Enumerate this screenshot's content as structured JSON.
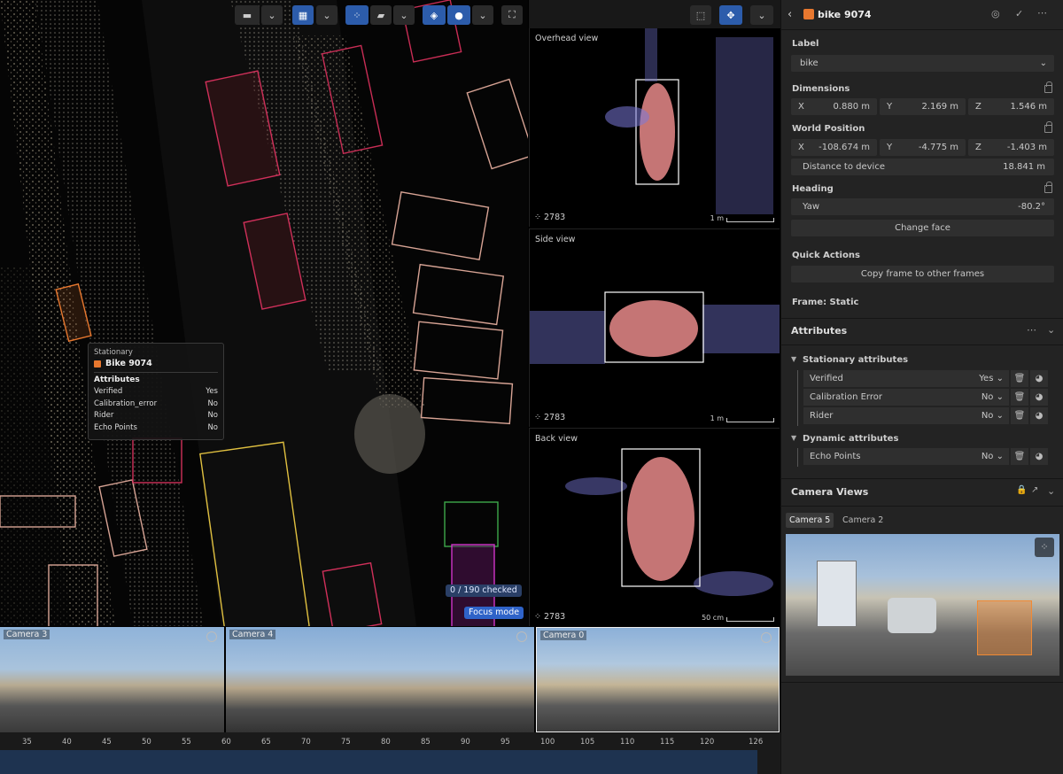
{
  "viewport": {
    "checked_badge": "0 / 190 checked",
    "focus_badge": "Focus mode",
    "toolbar": [
      "video-camera-icon",
      "chevron-down-icon",
      "layout-grid-icon",
      "chevron-down-icon",
      "points-icon",
      "tag-icon",
      "chevron-down-icon",
      "layers-icon",
      "circle-icon",
      "chevron-down-icon",
      "fullscreen-icon"
    ]
  },
  "tooltip": {
    "state": "Stationary",
    "object": "Bike 9074",
    "section": "Attributes",
    "rows": [
      {
        "k": "Verified",
        "v": "Yes"
      },
      {
        "k": "Calibration_error",
        "v": "No"
      },
      {
        "k": "Rider",
        "v": "No"
      },
      {
        "k": "Echo Points",
        "v": "No"
      }
    ]
  },
  "views": [
    {
      "title": "Overhead view",
      "count": "2783",
      "scale": "1 m"
    },
    {
      "title": "Side view",
      "count": "2783",
      "scale": "1 m"
    },
    {
      "title": "Back view",
      "count": "2783",
      "scale": "50 cm"
    }
  ],
  "panel": {
    "title": "bike 9074",
    "accent": "#e8782f",
    "label_heading": "Label",
    "label_value": "bike",
    "dimensions_heading": "Dimensions",
    "dimensions": [
      {
        "axis": "X",
        "value": "0.880 m"
      },
      {
        "axis": "Y",
        "value": "2.169 m"
      },
      {
        "axis": "Z",
        "value": "1.546 m"
      }
    ],
    "world_heading": "World Position",
    "world": [
      {
        "axis": "X",
        "value": "-108.674 m"
      },
      {
        "axis": "Y",
        "value": "-4.775 m"
      },
      {
        "axis": "Z",
        "value": "-1.403 m"
      }
    ],
    "distance_label": "Distance to device",
    "distance_value": "18.841 m",
    "heading_heading": "Heading",
    "yaw_label": "Yaw",
    "yaw_value": "-80.2°",
    "change_face": "Change face",
    "quick_actions": "Quick Actions",
    "copy_frame": "Copy frame to other frames",
    "frame_static": "Frame: Static",
    "attributes_heading": "Attributes",
    "stationary_group": "Stationary attributes",
    "stationary": [
      {
        "name": "Verified",
        "value": "Yes"
      },
      {
        "name": "Calibration Error",
        "value": "No"
      },
      {
        "name": "Rider",
        "value": "No"
      }
    ],
    "dynamic_group": "Dynamic attributes",
    "dynamic": [
      {
        "name": "Echo Points",
        "value": "No"
      }
    ],
    "camera_views_heading": "Camera Views",
    "camera_tabs": [
      "Camera 5",
      "Camera 2"
    ]
  },
  "cameras": [
    "Camera 3",
    "Camera 4",
    "Camera 0"
  ],
  "timeline_ticks": [
    "35",
    "40",
    "45",
    "50",
    "55",
    "60",
    "65",
    "70",
    "75",
    "80",
    "85",
    "90",
    "95",
    "100",
    "105",
    "110",
    "115",
    "120",
    "126"
  ]
}
